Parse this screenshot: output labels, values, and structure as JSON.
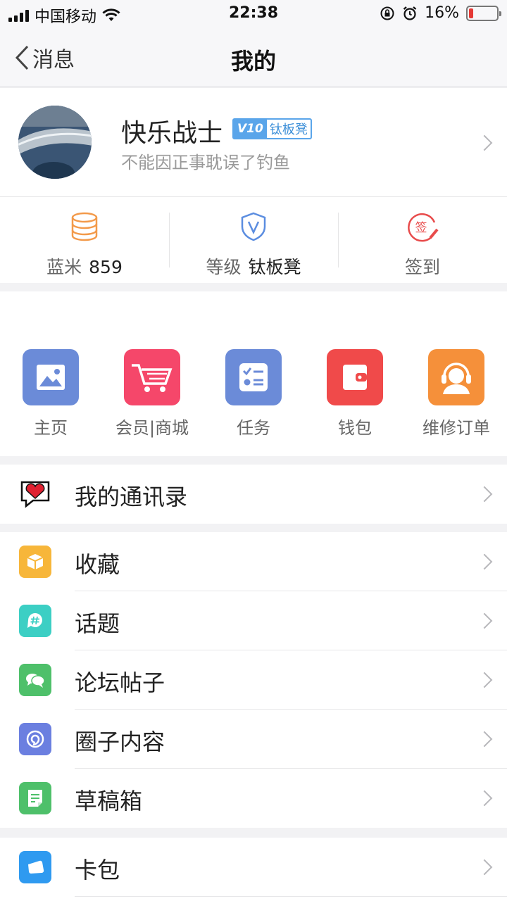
{
  "status_bar": {
    "carrier": "中国移动",
    "time": "22:38",
    "battery": "16%",
    "battery_level": 0.16
  },
  "nav": {
    "back_label": "消息",
    "title": "我的"
  },
  "profile": {
    "name": "快乐战士",
    "badge_level": "V10",
    "badge_title": "钛板凳",
    "signature": "不能因正事耽误了钓鱼"
  },
  "stats": [
    {
      "label": "蓝米",
      "value": "859",
      "icon": "coins-icon",
      "color": "#f39a4a"
    },
    {
      "label": "等级",
      "value": "钛板凳",
      "icon": "shield-v-icon",
      "color": "#5b8de0"
    },
    {
      "label": "签到",
      "value": "",
      "icon": "sign-in-icon",
      "color": "#e84b4b",
      "icon_text": "签"
    }
  ],
  "grid": [
    {
      "label": "主页",
      "icon": "picture-icon",
      "color": "#6b8bd8"
    },
    {
      "label": "会员|商城",
      "icon": "shopping-cart-icon",
      "color": "#f5476a"
    },
    {
      "label": "任务",
      "icon": "task-list-icon",
      "color": "#6b8bd8"
    },
    {
      "label": "钱包",
      "icon": "wallet-icon",
      "color": "#f04a4a"
    },
    {
      "label": "维修订单",
      "icon": "customer-service-icon",
      "color": "#f5903a"
    }
  ],
  "contacts": {
    "label": "我的通讯录",
    "icon": "heart-chat-icon"
  },
  "menu": [
    {
      "label": "收藏",
      "icon": "box-icon",
      "color": "#f7b63a"
    },
    {
      "label": "话题",
      "icon": "hashtag-icon",
      "color": "#3ccfc4"
    },
    {
      "label": "论坛帖子",
      "icon": "chat-bubbles-icon",
      "color": "#4ec06a"
    },
    {
      "label": "圈子内容",
      "icon": "circle-swirl-icon",
      "color": "#6b7fe0"
    },
    {
      "label": "草稿箱",
      "icon": "draft-icon",
      "color": "#4ec06a"
    }
  ],
  "wallet_menu": [
    {
      "label": "卡包",
      "icon": "card-icon",
      "color": "#2f9af0"
    }
  ]
}
